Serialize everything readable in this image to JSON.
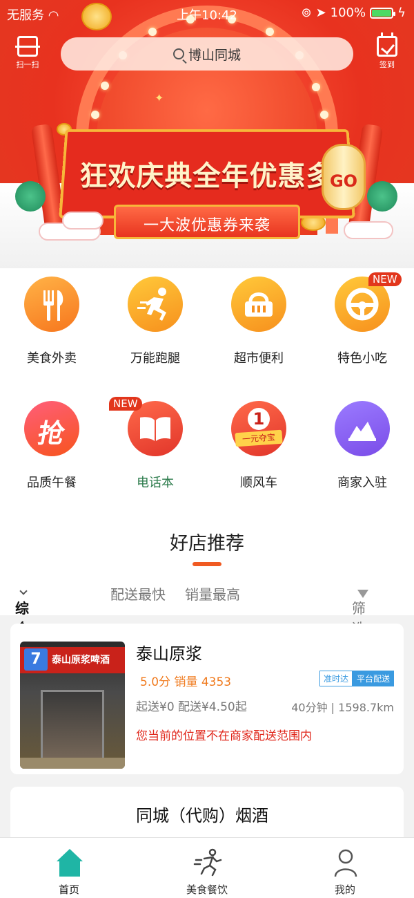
{
  "status_bar": {
    "carrier": "无服务",
    "time": "上午10:42",
    "battery": "100%"
  },
  "header": {
    "scan_label": "扫一扫",
    "search_placeholder": "博山同城",
    "signin_label": "签到"
  },
  "banner": {
    "title": "狂欢庆典全年优惠多",
    "subtitle": "一大波优惠券来袭",
    "lantern_text": "GO"
  },
  "categories": [
    {
      "label": "美食外卖",
      "icon": "fork-knife-icon",
      "new": false
    },
    {
      "label": "万能跑腿",
      "icon": "runner-icon",
      "new": false
    },
    {
      "label": "超市便利",
      "icon": "basket-icon",
      "new": false
    },
    {
      "label": "特色小吃",
      "icon": "steering-wheel-icon",
      "new": true,
      "badge": "NEW"
    },
    {
      "label": "品质午餐",
      "icon": "grab-char-icon",
      "new": false,
      "glyph": "抢"
    },
    {
      "label": "电话本",
      "icon": "book-icon",
      "new": true,
      "badge": "NEW"
    },
    {
      "label": "顺风车",
      "icon": "treasure-icon",
      "new": false,
      "glyph": "1",
      "sub_glyph": "一元夺宝"
    },
    {
      "label": "商家入驻",
      "icon": "mountain-icon",
      "new": false
    }
  ],
  "section": {
    "title": "好店推荐"
  },
  "sort": {
    "comprehensive": "综合排序",
    "fastest": "配送最快",
    "top_sales": "销量最高",
    "filter": "筛选"
  },
  "stores": [
    {
      "name": "泰山原浆",
      "rating": "5.0分",
      "sales": "销量 4353",
      "tag_ontime": "准时达",
      "tag_platform": "平台配送",
      "min_order": "起送¥0",
      "delivery_fee": "配送¥4.50起",
      "eta": "40分钟 | 1598.7km",
      "warning": "您当前的位置不在商家配送范围内",
      "sign_text": "泰山原浆啤酒"
    },
    {
      "name": "同城（代购）烟酒"
    }
  ],
  "tabbar": {
    "home": "首页",
    "food": "美食餐饮",
    "me": "我的"
  },
  "colors": {
    "accent": "#f05a22",
    "teal": "#1fb5a5",
    "warning": "#e0261a",
    "tag_blue": "#3a9ae0"
  }
}
